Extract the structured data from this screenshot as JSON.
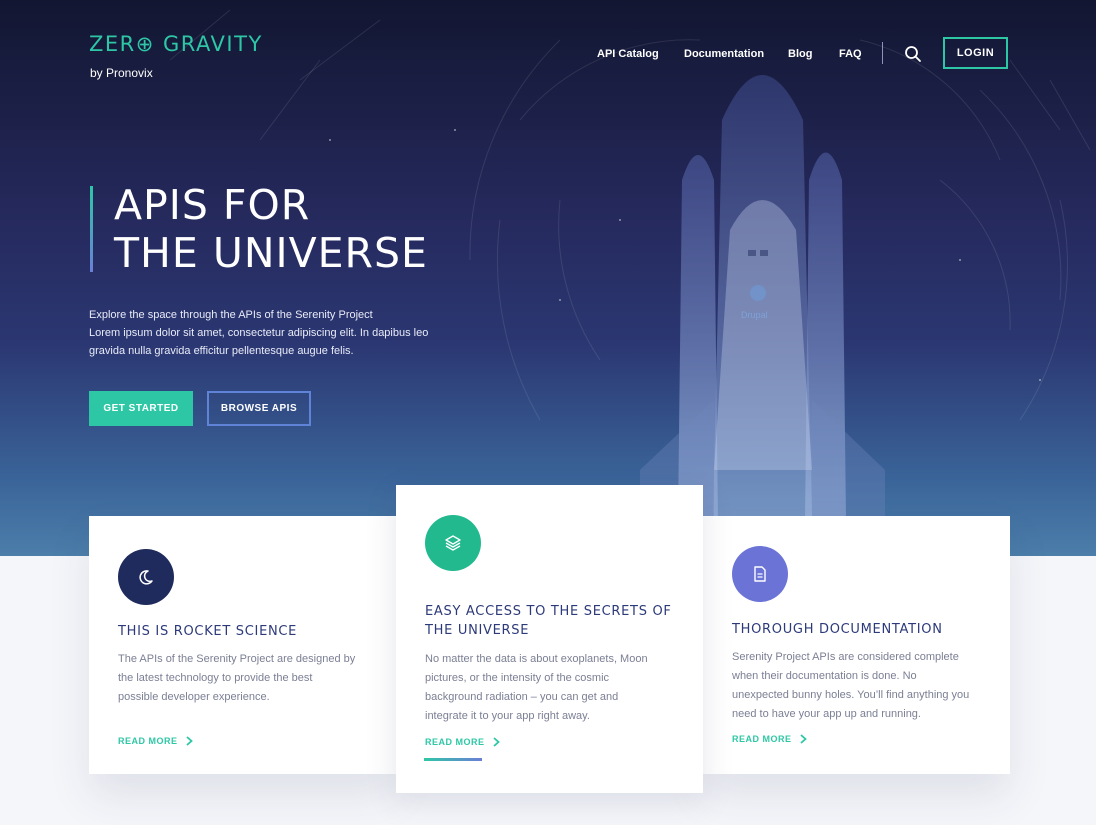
{
  "header": {
    "logo": "ZER⊕ GRAVITY",
    "logo_sub": "by Pronovix",
    "nav": [
      "API Catalog",
      "Documentation",
      "Blog",
      "FAQ"
    ],
    "search_icon": "search-icon",
    "login": "LOGIN"
  },
  "hero": {
    "title_line1": "APIS FOR",
    "title_line2": "THE UNIVERSE",
    "desc_line1": "Explore the space through the APIs of the Serenity Project",
    "desc_line2": "Lorem ipsum dolor sit amet, consectetur adipiscing elit. In dapibus leo",
    "desc_line3": "gravida nulla gravida efficitur pellentesque augue felis.",
    "primary_button": "GET STARTED",
    "secondary_button": "BROWSE APIS",
    "rocket_label": "Drupal"
  },
  "cards": [
    {
      "icon": "moon-icon",
      "title_lines": [
        "THIS IS ROCKET SCIENCE"
      ],
      "text_lines": [
        "The APIs of the Serenity Project are designed by",
        "the latest technology to provide the best",
        "possible developer experience."
      ],
      "link": "READ MORE"
    },
    {
      "icon": "layers-icon",
      "title_lines": [
        "EASY ACCESS TO THE SECRETS OF",
        "THE UNIVERSE"
      ],
      "text_lines": [
        "No matter the data is about exoplanets, Moon",
        "pictures, or the intensity of the cosmic",
        "background radiation – you can get and",
        "integrate it to your app right away."
      ],
      "link": "READ MORE"
    },
    {
      "icon": "document-icon",
      "title_lines": [
        "THOROUGH DOCUMENTATION"
      ],
      "text_lines": [
        "Serenity Project APIs are considered complete",
        "when their documentation is done. No",
        "unexpected bunny holes. You’ll find anything you",
        "need to have your app up and running."
      ],
      "link": "READ MORE"
    }
  ],
  "colors": {
    "accent": "#2ec7a6",
    "secondary_accent": "#6b7fd6",
    "navy": "#1f2b5c",
    "heading": "#2d3a7a"
  }
}
